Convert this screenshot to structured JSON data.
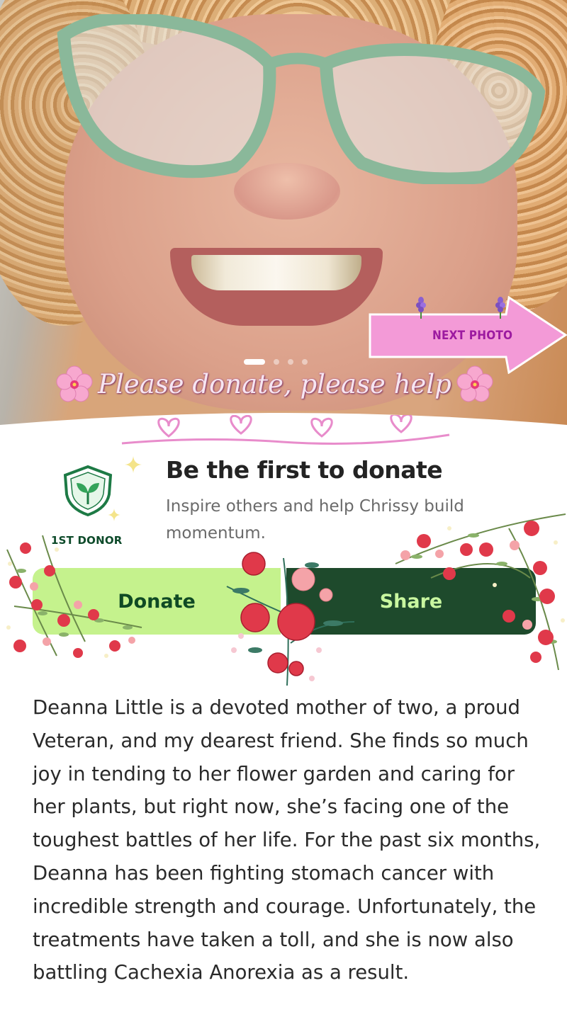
{
  "hero": {
    "caption": "Please donate, please help",
    "next_photo_label": "NEXT PHOTO",
    "carousel": {
      "total": 4,
      "active": 1
    }
  },
  "donor_card": {
    "badge_label": "1ST DONOR",
    "title": "Be the first to donate",
    "subtitle": "Inspire others and help Chrissy build momentum."
  },
  "actions": {
    "donate_label": "Donate",
    "share_label": "Share"
  },
  "story": {
    "text": "Deanna Little is a devoted mother of two, a proud Veteran, and my dearest friend. She finds so much joy in tending to her flower garden and caring for her plants, but right now, she’s facing one of the toughest battles of her life. For the past six months, Deanna has been fighting stomach cancer with incredible strength and courage. Unfortunately, the treatments have taken a toll, and she is now also battling Cachexia Anorexia as a result."
  },
  "colors": {
    "donate_bg": "#c5f28d",
    "share_bg": "#1e4a2c",
    "brand_green": "#0f4a24",
    "caption_pink": "#f6e6f1",
    "arrow_pink": "#f39ad7",
    "heart_pink": "#e88ccb"
  },
  "icons": {
    "badge": "shield-seedling-icon",
    "next_photo_flowers": "lavender-icon",
    "caption_flowers": "pink-blossom-icon",
    "card_sparkles": "sparkle-icon",
    "divider": "heart-icon",
    "button_decor": "rose-bouquet-icon"
  }
}
